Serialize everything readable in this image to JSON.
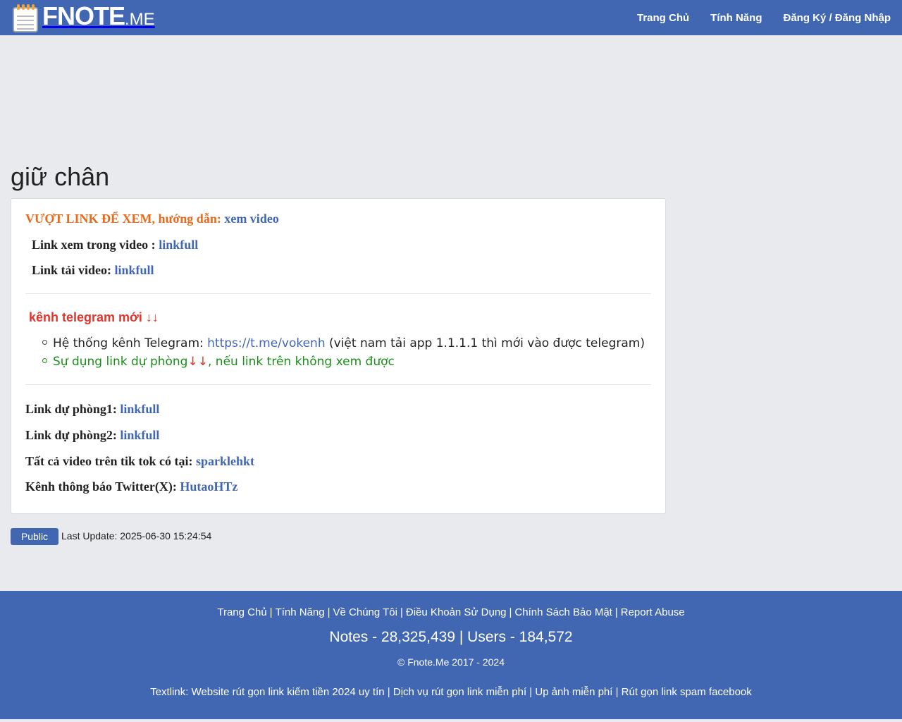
{
  "header": {
    "logo_main": "FNOTE",
    "logo_tld": ".ME",
    "nav": [
      "Trang Chủ",
      "Tính Năng",
      "Đăng Ký / Đăng Nhập"
    ]
  },
  "note": {
    "title": "giữ chân",
    "line1_prefix": "VƯỢT LINK ĐỂ XEM, hướng dẫn: ",
    "line1_link": "xem video",
    "line2_prefix": "Link xem trong video : ",
    "line2_link": "linkfull",
    "line3_prefix": "Link tải video: ",
    "line3_link": "linkfull",
    "telegram_heading": "kênh telegram mới ↓↓",
    "bullet1_prefix": "Hệ thống kênh Telegram: ",
    "bullet1_link": "https://t.me/vokenh",
    "bullet1_suffix": " (việt nam tải app 1.1.1.1 thì mới vào được telegram)",
    "bullet2_prefix": "Sự dụng link dự phòng",
    "bullet2_arrows": "↓↓",
    "bullet2_suffix": ", nếu link trên không xem được",
    "backup1_prefix": "Link dự phòng1: ",
    "backup1_link": "linkfull",
    "backup2_prefix": "Link dự phòng2: ",
    "backup2_link": "linkfull",
    "tiktok_prefix": "Tất cả video trên tik tok có tại: ",
    "tiktok_link": "sparklehkt",
    "twitter_prefix": "Kênh thông báo Twitter(X): ",
    "twitter_link": "HutaoHTz"
  },
  "meta": {
    "visibility": "Public",
    "last_update": "Last Update: 2025-06-30 15:24:54"
  },
  "footer": {
    "links": [
      "Trang Chủ",
      "Tính Năng",
      "Về Chúng Tôi",
      "Điều Khoản Sử Dụng",
      "Chính Sách Bảo Mật",
      "Report Abuse"
    ],
    "stats": "Notes - 28,325,439 | Users - 184,572",
    "copyright": "© Fnote.Me 2017 - 2024",
    "textlink_label": "Textlink: ",
    "textlinks": [
      "Website rút gọn link kiếm tiền 2024 uy tín",
      "Dịch vụ rút gọn link miễn phí",
      "Up ảnh miễn phí",
      "Rút gọn link spam facebook"
    ]
  },
  "colors": {
    "brand": "#4267b2",
    "background": "#e9eaed",
    "orange": "#e86a1b",
    "red": "#e0352b",
    "green": "#1a8f1a"
  }
}
